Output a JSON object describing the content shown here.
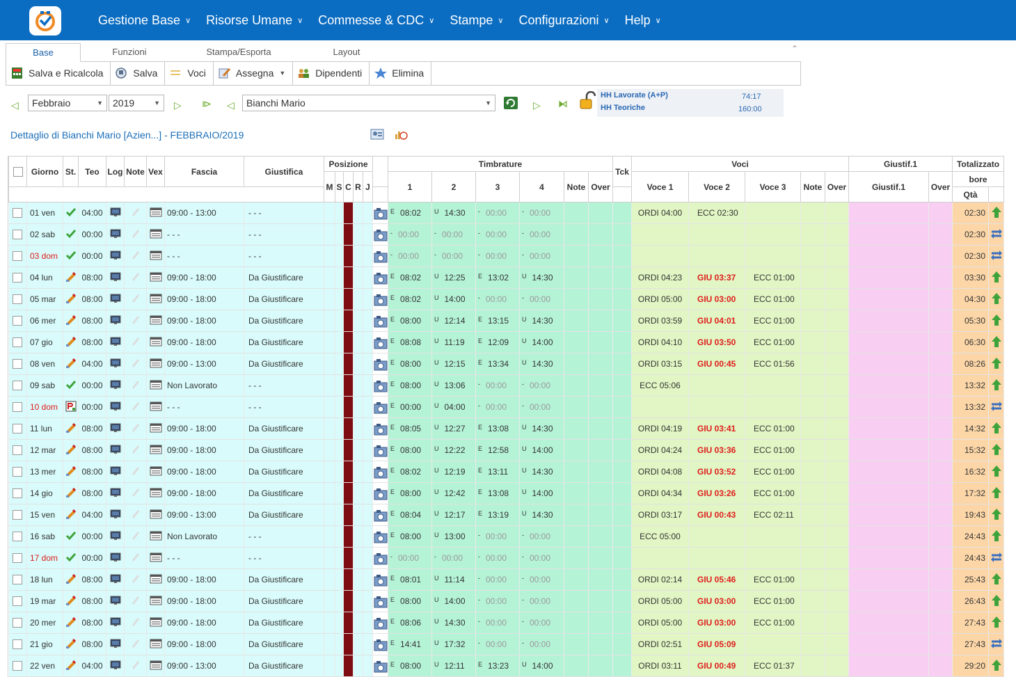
{
  "app": {
    "menu": [
      "Gestione Base",
      "Risorse Umane",
      "Commesse & CDC",
      "Stampe",
      "Configurazioni",
      "Help"
    ]
  },
  "tabs": [
    "Base",
    "Funzioni",
    "Stampa/Esporta",
    "Layout"
  ],
  "toolbar": [
    "Salva e Ricalcola",
    "Salva",
    "Voci",
    "Assegna",
    "Dipendenti",
    "Elimina"
  ],
  "filters": {
    "month": "Febbraio",
    "year": "2019",
    "employee": "Bianchi Mario"
  },
  "hh": {
    "lavorate_label": "HH Lavorate (A+P)",
    "lavorate_value": "74:17",
    "teoriche_label": "HH Teoriche",
    "teoriche_value": "160:00"
  },
  "detail_title": "Dettaglio di Bianchi Mario [Azien...] - FEBBRAIO/2019",
  "headers": {
    "giorno": "Giorno",
    "st": "St.",
    "teo": "Teo",
    "log": "Log",
    "note": "Note",
    "vex": "Vex",
    "fascia": "Fascia",
    "giustifica": "Giustifica",
    "posizione": "Posizione",
    "pos_cols": [
      "M",
      "S",
      "C",
      "R",
      "J"
    ],
    "timbrature": "Timbrature",
    "timb_cols": [
      "1",
      "2",
      "3",
      "4"
    ],
    "t_note": "Note",
    "t_over": "Over",
    "tck": "Tck",
    "voci": "Voci",
    "voce_cols": [
      "Voce 1",
      "Voce 2",
      "Voce 3"
    ],
    "v_note": "Note",
    "v_over": "Over",
    "giustif": "Giustif.1",
    "giustif_col": "Giustif.1",
    "g_over": "Over",
    "totalizzato": "Totalizzato",
    "bore": "bore",
    "qta": "Qtà"
  },
  "rows": [
    {
      "day": "01 ven",
      "red": false,
      "st": "check",
      "teo": "04:00",
      "fascia": "09:00 - 13:00",
      "giust": "- - -",
      "t": [
        [
          "E",
          "08:02"
        ],
        [
          "U",
          "14:30"
        ],
        [
          "-",
          "00:00"
        ],
        [
          "-",
          "00:00"
        ]
      ],
      "v": [
        "ORDI 04:00",
        "ECC 02:30",
        ""
      ],
      "v2red": false,
      "tot": "02:30",
      "trend": "up"
    },
    {
      "day": "02 sab",
      "red": false,
      "st": "check",
      "teo": "00:00",
      "fascia": "- - -",
      "giust": "- - -",
      "t": [
        [
          "-",
          "00:00"
        ],
        [
          "-",
          "00:00"
        ],
        [
          "-",
          "00:00"
        ],
        [
          "-",
          "00:00"
        ]
      ],
      "v": [
        "",
        "",
        ""
      ],
      "v2red": false,
      "tot": "02:30",
      "trend": "swap"
    },
    {
      "day": "03 dom",
      "red": true,
      "st": "check",
      "teo": "00:00",
      "fascia": "- - -",
      "giust": "- - -",
      "t": [
        [
          "-",
          "00:00"
        ],
        [
          "-",
          "00:00"
        ],
        [
          "-",
          "00:00"
        ],
        [
          "-",
          "00:00"
        ]
      ],
      "v": [
        "",
        "",
        ""
      ],
      "v2red": false,
      "tot": "02:30",
      "trend": "swap"
    },
    {
      "day": "04 lun",
      "red": false,
      "st": "warn",
      "teo": "08:00",
      "fascia": "09:00 - 18:00",
      "giust": "Da Giustificare",
      "t": [
        [
          "E",
          "08:02"
        ],
        [
          "U",
          "12:25"
        ],
        [
          "E",
          "13:02"
        ],
        [
          "U",
          "14:30"
        ]
      ],
      "v": [
        "ORDI 04:23",
        "GIU 03:37",
        "ECC 01:00"
      ],
      "v2red": true,
      "tot": "03:30",
      "trend": "up"
    },
    {
      "day": "05 mar",
      "red": false,
      "st": "warn",
      "teo": "08:00",
      "fascia": "09:00 - 18:00",
      "giust": "Da Giustificare",
      "t": [
        [
          "E",
          "08:02"
        ],
        [
          "U",
          "14:00"
        ],
        [
          "-",
          "00:00"
        ],
        [
          "-",
          "00:00"
        ]
      ],
      "v": [
        "ORDI 05:00",
        "GIU 03:00",
        "ECC 01:00"
      ],
      "v2red": true,
      "tot": "04:30",
      "trend": "up"
    },
    {
      "day": "06 mer",
      "red": false,
      "st": "warn",
      "teo": "08:00",
      "fascia": "09:00 - 18:00",
      "giust": "Da Giustificare",
      "t": [
        [
          "E",
          "08:00"
        ],
        [
          "U",
          "12:14"
        ],
        [
          "E",
          "13:15"
        ],
        [
          "U",
          "14:30"
        ]
      ],
      "v": [
        "ORDI 03:59",
        "GIU 04:01",
        "ECC 01:00"
      ],
      "v2red": true,
      "tot": "05:30",
      "trend": "up"
    },
    {
      "day": "07 gio",
      "red": false,
      "st": "warn",
      "teo": "08:00",
      "fascia": "09:00 - 18:00",
      "giust": "Da Giustificare",
      "t": [
        [
          "E",
          "08:08"
        ],
        [
          "U",
          "11:19"
        ],
        [
          "E",
          "12:09"
        ],
        [
          "U",
          "14:00"
        ]
      ],
      "v": [
        "ORDI 04:10",
        "GIU 03:50",
        "ECC 01:00"
      ],
      "v2red": true,
      "tot": "06:30",
      "trend": "up"
    },
    {
      "day": "08 ven",
      "red": false,
      "st": "warn",
      "teo": "04:00",
      "fascia": "09:00 - 13:00",
      "giust": "Da Giustificare",
      "t": [
        [
          "E",
          "08:00"
        ],
        [
          "U",
          "12:15"
        ],
        [
          "E",
          "13:34"
        ],
        [
          "U",
          "14:30"
        ]
      ],
      "v": [
        "ORDI 03:15",
        "GIU 00:45",
        "ECC 01:56"
      ],
      "v2red": true,
      "tot": "08:26",
      "trend": "up"
    },
    {
      "day": "09 sab",
      "red": false,
      "st": "check",
      "teo": "00:00",
      "fascia": "Non Lavorato",
      "giust": "- - -",
      "t": [
        [
          "E",
          "08:00"
        ],
        [
          "U",
          "13:06"
        ],
        [
          "-",
          "00:00"
        ],
        [
          "-",
          "00:00"
        ]
      ],
      "v": [
        "ECC 05:06",
        "",
        ""
      ],
      "v2red": false,
      "tot": "13:32",
      "trend": "up"
    },
    {
      "day": "10 dom",
      "red": true,
      "st": "doc",
      "teo": "00:00",
      "fascia": "- - -",
      "giust": "- - -",
      "t": [
        [
          "E",
          "00:00"
        ],
        [
          "U",
          "04:00"
        ],
        [
          "-",
          "00:00"
        ],
        [
          "-",
          "00:00"
        ]
      ],
      "v": [
        "",
        "",
        ""
      ],
      "v2red": false,
      "tot": "13:32",
      "trend": "swap"
    },
    {
      "day": "11 lun",
      "red": false,
      "st": "warn",
      "teo": "08:00",
      "fascia": "09:00 - 18:00",
      "giust": "Da Giustificare",
      "t": [
        [
          "E",
          "08:05"
        ],
        [
          "U",
          "12:27"
        ],
        [
          "E",
          "13:08"
        ],
        [
          "U",
          "14:30"
        ]
      ],
      "v": [
        "ORDI 04:19",
        "GIU 03:41",
        "ECC 01:00"
      ],
      "v2red": true,
      "tot": "14:32",
      "trend": "up"
    },
    {
      "day": "12 mar",
      "red": false,
      "st": "warn",
      "teo": "08:00",
      "fascia": "09:00 - 18:00",
      "giust": "Da Giustificare",
      "t": [
        [
          "E",
          "08:00"
        ],
        [
          "U",
          "12:22"
        ],
        [
          "E",
          "12:58"
        ],
        [
          "U",
          "14:00"
        ]
      ],
      "v": [
        "ORDI 04:24",
        "GIU 03:36",
        "ECC 01:00"
      ],
      "v2red": true,
      "tot": "15:32",
      "trend": "up"
    },
    {
      "day": "13 mer",
      "red": false,
      "st": "warn",
      "teo": "08:00",
      "fascia": "09:00 - 18:00",
      "giust": "Da Giustificare",
      "t": [
        [
          "E",
          "08:02"
        ],
        [
          "U",
          "12:19"
        ],
        [
          "E",
          "13:11"
        ],
        [
          "U",
          "14:30"
        ]
      ],
      "v": [
        "ORDI 04:08",
        "GIU 03:52",
        "ECC 01:00"
      ],
      "v2red": true,
      "tot": "16:32",
      "trend": "up"
    },
    {
      "day": "14 gio",
      "red": false,
      "st": "warn",
      "teo": "08:00",
      "fascia": "09:00 - 18:00",
      "giust": "Da Giustificare",
      "t": [
        [
          "E",
          "08:00"
        ],
        [
          "U",
          "12:42"
        ],
        [
          "E",
          "13:08"
        ],
        [
          "U",
          "14:00"
        ]
      ],
      "v": [
        "ORDI 04:34",
        "GIU 03:26",
        "ECC 01:00"
      ],
      "v2red": true,
      "tot": "17:32",
      "trend": "up"
    },
    {
      "day": "15 ven",
      "red": false,
      "st": "warn",
      "teo": "04:00",
      "fascia": "09:00 - 13:00",
      "giust": "Da Giustificare",
      "t": [
        [
          "E",
          "08:04"
        ],
        [
          "U",
          "12:17"
        ],
        [
          "E",
          "13:19"
        ],
        [
          "U",
          "14:30"
        ]
      ],
      "v": [
        "ORDI 03:17",
        "GIU 00:43",
        "ECC 02:11"
      ],
      "v2red": true,
      "tot": "19:43",
      "trend": "up"
    },
    {
      "day": "16 sab",
      "red": false,
      "st": "check",
      "teo": "00:00",
      "fascia": "Non Lavorato",
      "giust": "- - -",
      "t": [
        [
          "E",
          "08:00"
        ],
        [
          "U",
          "13:00"
        ],
        [
          "-",
          "00:00"
        ],
        [
          "-",
          "00:00"
        ]
      ],
      "v": [
        "ECC 05:00",
        "",
        ""
      ],
      "v2red": false,
      "tot": "24:43",
      "trend": "up"
    },
    {
      "day": "17 dom",
      "red": true,
      "st": "check",
      "teo": "00:00",
      "fascia": "- - -",
      "giust": "- - -",
      "t": [
        [
          "-",
          "00:00"
        ],
        [
          "-",
          "00:00"
        ],
        [
          "-",
          "00:00"
        ],
        [
          "-",
          "00:00"
        ]
      ],
      "v": [
        "",
        "",
        ""
      ],
      "v2red": false,
      "tot": "24:43",
      "trend": "swap"
    },
    {
      "day": "18 lun",
      "red": false,
      "st": "warn",
      "teo": "08:00",
      "fascia": "09:00 - 18:00",
      "giust": "Da Giustificare",
      "t": [
        [
          "E",
          "08:01"
        ],
        [
          "U",
          "11:14"
        ],
        [
          "-",
          "00:00"
        ],
        [
          "-",
          "00:00"
        ]
      ],
      "v": [
        "ORDI 02:14",
        "GIU 05:46",
        "ECC 01:00"
      ],
      "v2red": true,
      "tot": "25:43",
      "trend": "up"
    },
    {
      "day": "19 mar",
      "red": false,
      "st": "warn",
      "teo": "08:00",
      "fascia": "09:00 - 18:00",
      "giust": "Da Giustificare",
      "t": [
        [
          "E",
          "08:00"
        ],
        [
          "U",
          "14:00"
        ],
        [
          "-",
          "00:00"
        ],
        [
          "-",
          "00:00"
        ]
      ],
      "v": [
        "ORDI 05:00",
        "GIU 03:00",
        "ECC 01:00"
      ],
      "v2red": true,
      "tot": "26:43",
      "trend": "up"
    },
    {
      "day": "20 mer",
      "red": false,
      "st": "warn",
      "teo": "08:00",
      "fascia": "09:00 - 18:00",
      "giust": "Da Giustificare",
      "t": [
        [
          "E",
          "08:06"
        ],
        [
          "U",
          "14:30"
        ],
        [
          "-",
          "00:00"
        ],
        [
          "-",
          "00:00"
        ]
      ],
      "v": [
        "ORDI 05:00",
        "GIU 03:00",
        "ECC 01:00"
      ],
      "v2red": true,
      "tot": "27:43",
      "trend": "up"
    },
    {
      "day": "21 gio",
      "red": false,
      "st": "warn",
      "teo": "08:00",
      "fascia": "09:00 - 18:00",
      "giust": "Da Giustificare",
      "t": [
        [
          "E",
          "14:41"
        ],
        [
          "U",
          "17:32"
        ],
        [
          "-",
          "00:00"
        ],
        [
          "-",
          "00:00"
        ]
      ],
      "v": [
        "ORDI 02:51",
        "GIU 05:09",
        ""
      ],
      "v2red": true,
      "tot": "27:43",
      "trend": "swap"
    },
    {
      "day": "22 ven",
      "red": false,
      "st": "warn",
      "teo": "04:00",
      "fascia": "09:00 - 13:00",
      "giust": "Da Giustificare",
      "t": [
        [
          "E",
          "08:00"
        ],
        [
          "U",
          "12:11"
        ],
        [
          "E",
          "13:23"
        ],
        [
          "U",
          "14:00"
        ]
      ],
      "v": [
        "ORDI 03:11",
        "GIU 00:49",
        "ECC 01:37"
      ],
      "v2red": true,
      "tot": "29:20",
      "trend": "up"
    }
  ]
}
